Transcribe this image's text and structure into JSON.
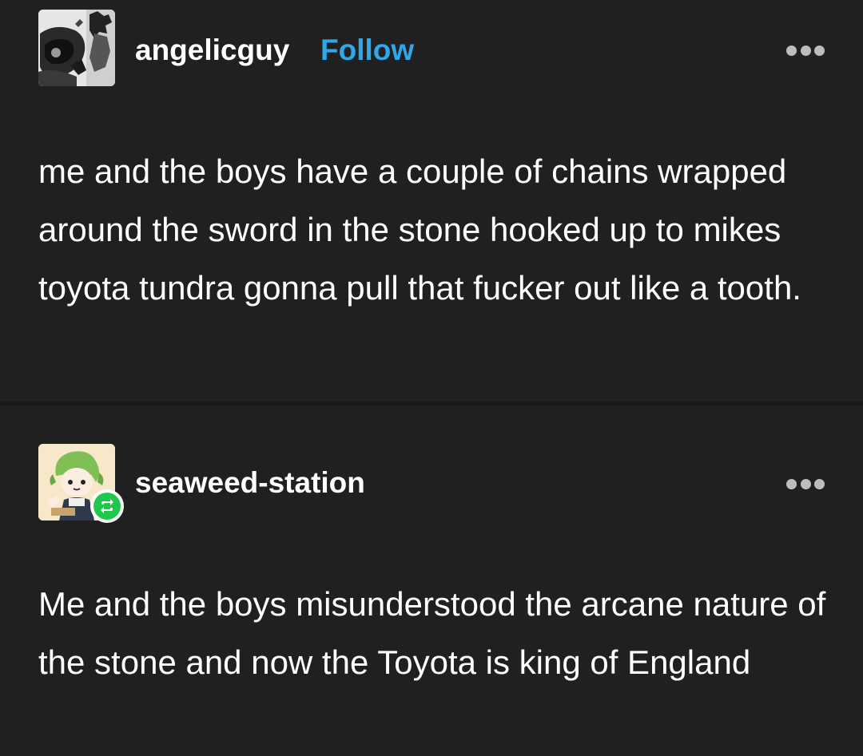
{
  "posts": [
    {
      "username": "angelicguy",
      "follow_label": "Follow",
      "avatar_icon": "manga-avatar",
      "more_icon": "more-options-icon",
      "body": "me and the boys have a couple of chains wrapped around the sword in the stone hooked up to mikes toyota tundra gonna pull that fucker out like a tooth."
    },
    {
      "username": "seaweed-station",
      "avatar_icon": "green-haired-character-avatar",
      "badge_icon": "reblog-icon",
      "more_icon": "more-options-icon",
      "body": "Me and the boys misunderstood the arcane nature of the stone and now the Toyota is king of England"
    }
  ],
  "colors": {
    "background": "#202020",
    "divider": "#1a1a1a",
    "follow": "#2ea8e8",
    "reblog_badge": "#1fc84a",
    "text": "#ffffff",
    "dots": "#bdbdbd"
  }
}
